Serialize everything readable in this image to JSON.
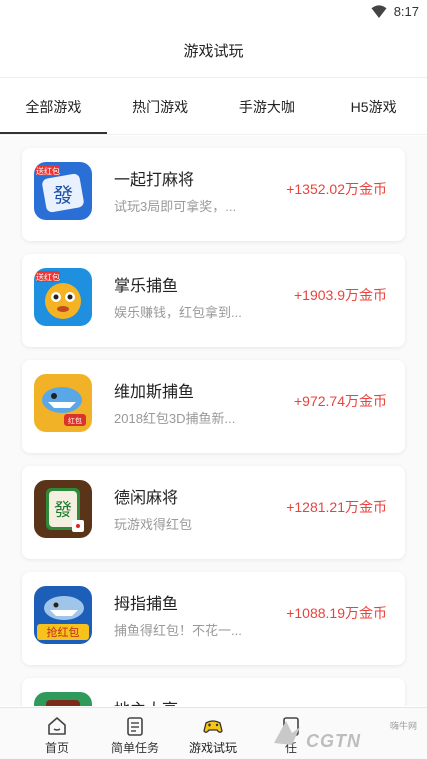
{
  "status_bar": {
    "time": "8:17"
  },
  "header": {
    "title": "游戏试玩"
  },
  "tabs": [
    {
      "label": "全部游戏",
      "active": true
    },
    {
      "label": "热门游戏",
      "active": false
    },
    {
      "label": "手游大咖",
      "active": false
    },
    {
      "label": "H5游戏",
      "active": false
    }
  ],
  "games": [
    {
      "name": "一起打麻将",
      "desc": "试玩3局即可拿奖，...",
      "reward": "+1352.02万金币",
      "icon": "mahjong-icon"
    },
    {
      "name": "掌乐捕鱼",
      "desc": "娱乐赚钱，红包拿到...",
      "reward": "+1903.9万金币",
      "icon": "fish-icon"
    },
    {
      "name": "维加斯捕鱼",
      "desc": "2018红包3D捕鱼新...",
      "reward": "+972.74万金币",
      "icon": "shark-icon"
    },
    {
      "name": "德闲麻将",
      "desc": "玩游戏得红包",
      "reward": "+1281.21万金币",
      "icon": "mahjong-tile-icon"
    },
    {
      "name": "拇指捕鱼",
      "desc": "捕鱼得红包！不花一...",
      "reward": "+1088.19万金币",
      "icon": "shark-hongbao-icon"
    },
    {
      "name": "地主大亨",
      "desc": "",
      "reward": "",
      "icon": "landlord-icon"
    }
  ],
  "bottom_nav": [
    {
      "label": "首页",
      "icon": "home-icon"
    },
    {
      "label": "简单任务",
      "icon": "task-icon"
    },
    {
      "label": "游戏试玩",
      "icon": "gamepad-icon",
      "active": true
    },
    {
      "label": "任",
      "icon": "task-icon"
    }
  ],
  "watermark": {
    "text": "CGTN",
    "small": "嗨牛网"
  },
  "colors": {
    "reward": "#e8433e",
    "text": "#222222",
    "muted": "#999999"
  }
}
